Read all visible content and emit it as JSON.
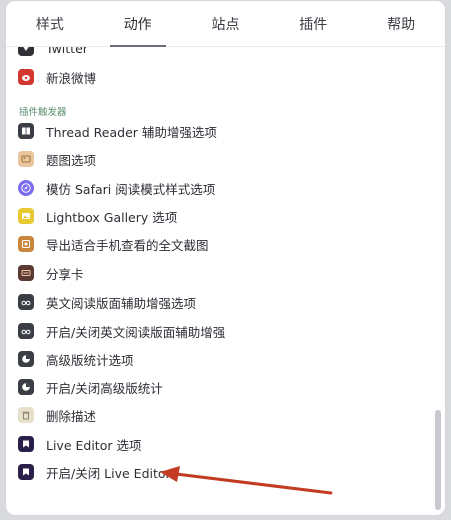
{
  "tabs": [
    {
      "label": "样式",
      "active": false
    },
    {
      "label": "动作",
      "active": true
    },
    {
      "label": "站点",
      "active": false
    },
    {
      "label": "插件",
      "active": false
    },
    {
      "label": "帮助",
      "active": false
    }
  ],
  "items_top": [
    {
      "label": "Twitter",
      "icon": "twitter-icon"
    },
    {
      "label": "新浪微博",
      "icon": "weibo-icon"
    }
  ],
  "section_title": "插件触发器",
  "items": [
    {
      "label": "Thread Reader 辅助增强选项",
      "icon": "book-icon"
    },
    {
      "label": "题图选项",
      "icon": "image-icon"
    },
    {
      "label": "模仿 Safari 阅读模式样式选项",
      "icon": "compass-icon"
    },
    {
      "label": "Lightbox Gallery 选项",
      "icon": "gallery-icon"
    },
    {
      "label": "导出适合手机查看的全文截图",
      "icon": "export-image-icon"
    },
    {
      "label": "分享卡",
      "icon": "share-card-icon"
    },
    {
      "label": "英文阅读版面辅助增强选项",
      "icon": "glasses-icon"
    },
    {
      "label": "开启/关闭英文阅读版面辅助增强",
      "icon": "glasses-icon"
    },
    {
      "label": "高级版统计选项",
      "icon": "pie-chart-icon"
    },
    {
      "label": "开启/关闭高级版统计",
      "icon": "pie-chart-icon"
    },
    {
      "label": "删除描述",
      "icon": "trash-icon"
    },
    {
      "label": "Live Editor 选项",
      "icon": "live-editor-icon"
    },
    {
      "label": "开启/关闭 Live Editor",
      "icon": "live-editor-icon"
    }
  ],
  "colors": {
    "accent_arrow": "#c23b22",
    "section": "#5a8d6f",
    "weibo": "#d4372f",
    "image": "#e8c59a",
    "compass": "#7b6cf0",
    "gallery": "#e9c931",
    "export": "#c9873e",
    "share": "#5a3a32",
    "dark": "#3b3e45",
    "purple_dark": "#2a1f4a"
  }
}
